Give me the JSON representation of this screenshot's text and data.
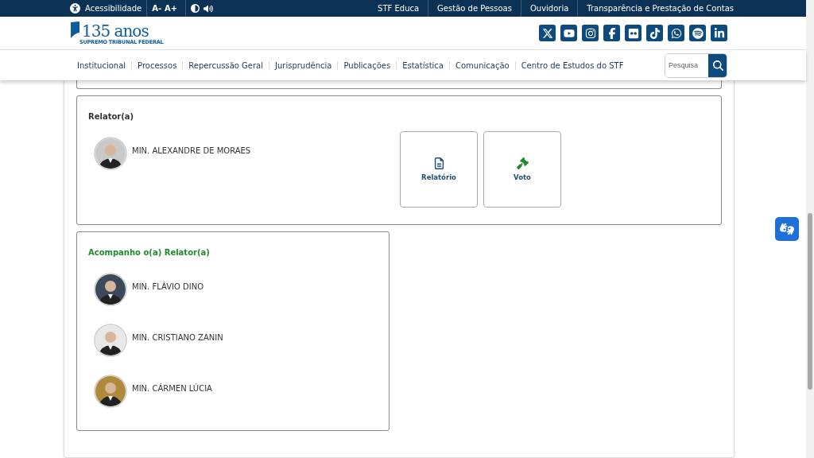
{
  "top_bar": {
    "accessibility": "Acessibilidade",
    "font_buttons": [
      "A-",
      "A+"
    ],
    "links": [
      "STF Educa",
      "Gestão de Pessoas",
      "Ouvidoria",
      "Transparência e Prestação de Contas"
    ]
  },
  "logo": {
    "number": "135",
    "word": "anos",
    "subtitle": "SUPREMO TRIBUNAL FEDERAL"
  },
  "socials": [
    {
      "kind": "x"
    },
    {
      "kind": "youtube"
    },
    {
      "kind": "instagram"
    },
    {
      "kind": "facebook"
    },
    {
      "kind": "flickr"
    },
    {
      "kind": "tiktok"
    },
    {
      "kind": "whatsapp"
    },
    {
      "kind": "spotify"
    },
    {
      "kind": "linkedin"
    }
  ],
  "nav": {
    "items": [
      "Institucional",
      "Processos",
      "Repercussão Geral",
      "Jurisprudência",
      "Publicações",
      "Estatística",
      "Comunicação",
      "Centro de Estudos do STF"
    ],
    "search": {
      "placeholder": "Pesquisa"
    }
  },
  "relator": {
    "title": "Relator(a)",
    "ministers": [
      {
        "name": "MIN. ALEXANDRE DE MORAES"
      }
    ],
    "actions": [
      {
        "kind": "document",
        "label": "Relatório"
      },
      {
        "kind": "gavel",
        "label": "Voto"
      }
    ]
  },
  "acompanha": {
    "title": "Acompanho o(a) Relator(a)",
    "ministers": [
      {
        "name": "MIN. FLÁVIO DINO"
      },
      {
        "name": "MIN. CRISTIANO ZANIN"
      },
      {
        "name": "MIN. CÁRMEN LÚCIA"
      }
    ]
  }
}
